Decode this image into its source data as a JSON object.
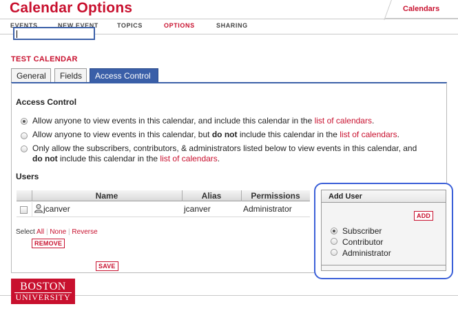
{
  "header": {
    "title": "Calendar Options",
    "top_tab": "Calendars"
  },
  "nav": {
    "items": [
      {
        "label": "EVENTS",
        "active": false
      },
      {
        "label": "NEW EVENT",
        "active": false
      },
      {
        "label": "TOPICS",
        "active": false
      },
      {
        "label": "OPTIONS",
        "active": true
      },
      {
        "label": "SHARING",
        "active": false
      }
    ]
  },
  "calendar_name": "TEST CALENDAR",
  "tabs": [
    {
      "label": "General",
      "active": false
    },
    {
      "label": "Fields",
      "active": false
    },
    {
      "label": "Access Control",
      "active": true
    }
  ],
  "access_control": {
    "heading": "Access Control",
    "options": [
      {
        "selected": true,
        "text_before": "Allow anyone to view events in this calendar, and include this calendar in the ",
        "link": "list of calendars",
        "text_after": "."
      },
      {
        "selected": false,
        "text_before": "Allow anyone to view events in this calendar, but ",
        "bold": "do not",
        "text_middle": " include this calendar in the ",
        "link": "list of calendars",
        "text_after": "."
      },
      {
        "selected": false,
        "line1": "Only allow the subscribers, contributors, & administrators listed below to view events in this calendar, and",
        "bold": "do not",
        "text_middle": " include this calendar in the ",
        "link": "list of calendars",
        "text_after": "."
      }
    ]
  },
  "users": {
    "heading": "Users",
    "columns": [
      "Name",
      "Alias",
      "Permissions"
    ],
    "rows": [
      {
        "name": "jcanver",
        "alias": "jcanver",
        "permissions": "Administrator"
      }
    ],
    "select_label": "Select",
    "select_links": [
      "All",
      "None",
      "Reverse"
    ],
    "remove_label": "REMOVE"
  },
  "save_label": "SAVE",
  "add_user": {
    "title": "Add User",
    "input_value": "",
    "add_label": "ADD",
    "roles": [
      {
        "label": "Subscriber",
        "selected": true
      },
      {
        "label": "Contributor",
        "selected": false
      },
      {
        "label": "Administrator",
        "selected": false
      }
    ]
  },
  "logo": {
    "line1": "BOSTON",
    "line2": "UNIVERSITY"
  },
  "colors": {
    "brand_red": "#c8102e",
    "tab_blue": "#3a5fa8",
    "highlight_blue": "#3a5fd8"
  }
}
